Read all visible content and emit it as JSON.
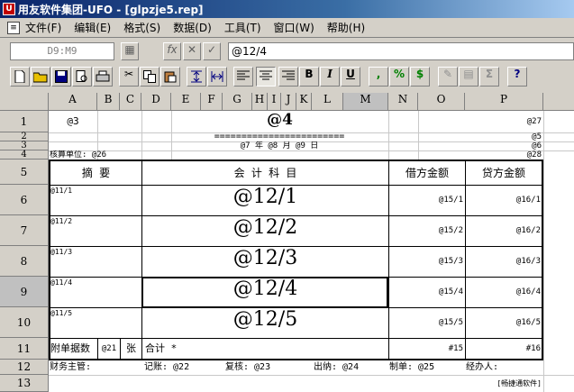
{
  "window": {
    "title": "用友软件集团-UFO - [glpzje5.rep]",
    "app_icon": "ufo-app-icon",
    "doc_icon": "report-document-icon"
  },
  "menu": [
    "文件(F)",
    "编辑(E)",
    "格式(S)",
    "数据(D)",
    "工具(T)",
    "窗口(W)",
    "帮助(H)"
  ],
  "formula_bar": {
    "cell_ref": "D9:M9",
    "fx_label": "fx",
    "cancel_label": "✕",
    "confirm_label": "✓",
    "value": "@12/4"
  },
  "toolbar": {
    "bold": "B",
    "italic": "I",
    "underline": "U",
    "comma": ",",
    "percent": "%",
    "currency": "$",
    "help": "?"
  },
  "grid": {
    "columns": [
      "A",
      "B",
      "C",
      "D",
      "E",
      "F",
      "G",
      "H",
      "I",
      "J",
      "K",
      "L",
      "M",
      "N",
      "O",
      "P"
    ],
    "active_column": "M",
    "rows": [
      "1",
      "2",
      "3",
      "4",
      "5",
      "6",
      "7",
      "8",
      "9",
      "10",
      "11",
      "12",
      "13"
    ],
    "active_row": "9"
  },
  "report": {
    "r1": {
      "a": "@3",
      "center": "@4",
      "p": "@27"
    },
    "r2": {
      "double_line": "========================",
      "p": "@5"
    },
    "r3": {
      "date": "@7 年 @8 月 @9 日",
      "p": "@6"
    },
    "r4": {
      "unit_label": "核算单位: @26",
      "p": "@28"
    },
    "header": {
      "summary": "摘    要",
      "account": "会  计  科  目",
      "debit": "借方金额",
      "credit": "贷方金额"
    },
    "entries": [
      {
        "summary": "@11/1",
        "account": "@12/1",
        "debit": "@15/1",
        "credit": "@16/1"
      },
      {
        "summary": "@11/2",
        "account": "@12/2",
        "debit": "@15/2",
        "credit": "@16/2"
      },
      {
        "summary": "@11/3",
        "account": "@12/3",
        "debit": "@15/3",
        "credit": "@16/3"
      },
      {
        "summary": "@11/4",
        "account": "@12/4",
        "debit": "@15/4",
        "credit": "@16/4"
      },
      {
        "summary": "@11/5",
        "account": "@12/5",
        "debit": "@15/5",
        "credit": "@16/5"
      }
    ],
    "r11": {
      "attach_label": "附单据数",
      "attach_val": "@21",
      "attach_unit": "张",
      "total_label": "合计 *",
      "debit_total": "#15",
      "credit_total": "#16"
    },
    "r12": {
      "supervisor": "财务主管:",
      "bookkeeper": "记账: @22",
      "reviewer": "复核: @23",
      "cashier": "出纳: @24",
      "maker": "制单: @25",
      "handler": "经办人:"
    },
    "r13": {
      "footer": "[畅捷通软件]"
    }
  }
}
